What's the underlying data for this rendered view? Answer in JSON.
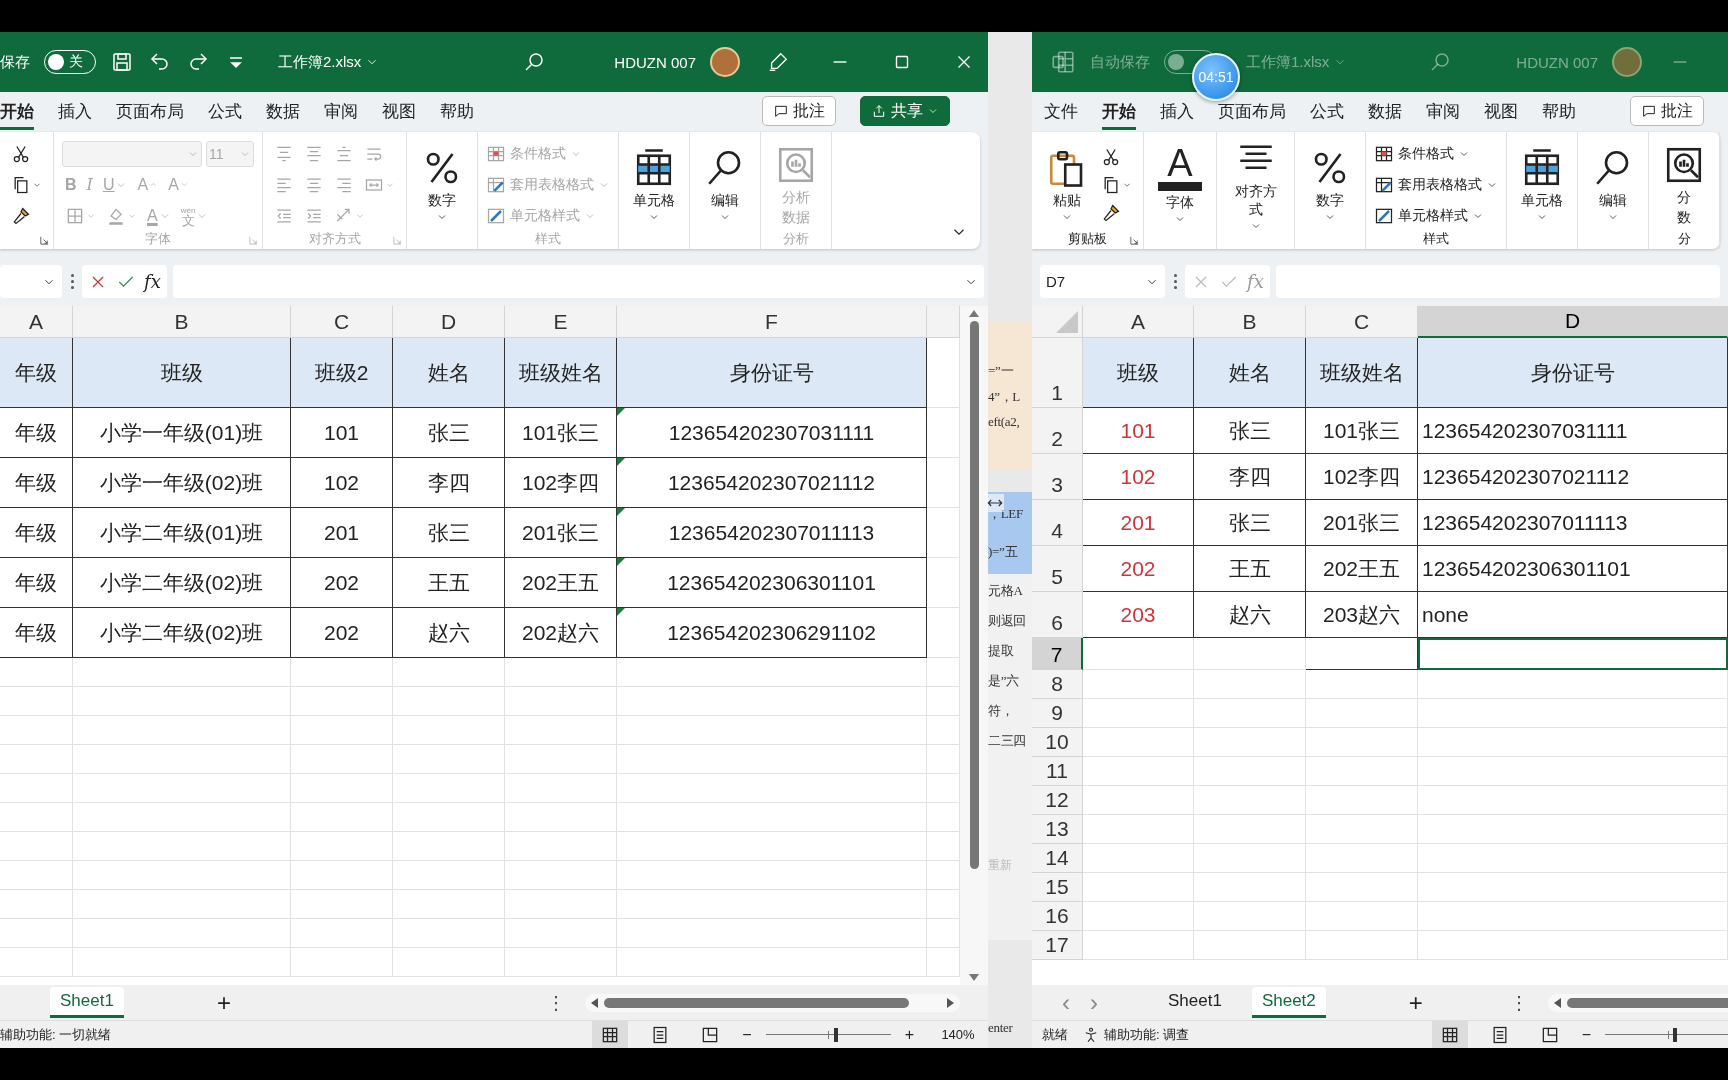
{
  "background_window": {
    "fragments": [
      {
        "kind": "code",
        "text": "=”一"
      },
      {
        "kind": "code",
        "text": "4”，L"
      },
      {
        "kind": "code",
        "text": "eft(a2,"
      },
      {
        "kind": "highlight",
        "text": "，LEF"
      },
      {
        "kind": "highlight",
        "text": ")=”五"
      },
      {
        "kind": "text",
        "text": "元格A"
      },
      {
        "kind": "text",
        "text": "则返回"
      },
      {
        "kind": "text",
        "text": "提取"
      },
      {
        "kind": "text",
        "text": "是”六"
      },
      {
        "kind": "text",
        "text": "符，"
      },
      {
        "kind": "text",
        "text": "二三四"
      },
      {
        "kind": "muted",
        "text": "重新"
      },
      {
        "kind": "footer",
        "text": "enter"
      }
    ]
  },
  "windows": [
    {
      "active": true,
      "title_bar": {
        "autosave_label": "保存",
        "autosave": {
          "on": false,
          "text": "关"
        },
        "quick_access": [
          {
            "kind": "save"
          },
          {
            "kind": "undo"
          },
          {
            "kind": "redo"
          },
          {
            "kind": "customize"
          }
        ],
        "filename": "工作簿2.xlsx",
        "user": "HDUZN 007",
        "controls": [
          {
            "kind": "pen"
          },
          {
            "kind": "minimize"
          },
          {
            "kind": "maximize"
          },
          {
            "kind": "close"
          }
        ]
      },
      "ribbon_tabs": [
        {
          "label": "开始",
          "selected": true
        },
        {
          "label": "插入",
          "selected": false
        },
        {
          "label": "页面布局",
          "selected": false
        },
        {
          "label": "公式",
          "selected": false
        },
        {
          "label": "数据",
          "selected": false
        },
        {
          "label": "审阅",
          "selected": false
        },
        {
          "label": "视图",
          "selected": false
        },
        {
          "label": "帮助",
          "selected": false
        }
      ],
      "ribbon_buttons": [
        {
          "kind": "comment",
          "label": "批注"
        },
        {
          "kind": "share",
          "label": "共享"
        }
      ],
      "ribbon_groups": [
        {
          "disabled": false,
          "launcher": true,
          "rows": [
            [
              {
                "kind": "cut"
              }
            ],
            [
              {
                "kind": "copy",
                "caret": true
              }
            ],
            [
              {
                "kind": "painter"
              }
            ]
          ]
        },
        {
          "label": "字体",
          "disabled": true,
          "launcher": true,
          "rows": [
            [
              {
                "kind": "fontname",
                "caret": true
              },
              {
                "kind": "fontsize",
                "text": "11",
                "caret": true
              }
            ],
            [
              {
                "kind": "bold",
                "text": "B"
              },
              {
                "kind": "italic",
                "text": "I"
              },
              {
                "kind": "underline",
                "text": "U",
                "caret": true
              },
              {
                "kind": "grow",
                "text": "A"
              },
              {
                "kind": "shrink",
                "text": "A"
              }
            ],
            [
              {
                "kind": "border",
                "caret": true
              },
              {
                "kind": "fill",
                "caret": true
              },
              {
                "kind": "fontcolor",
                "text": "A",
                "caret": true
              },
              {
                "kind": "phonetic",
                "text": "文",
                "ruby": "wén",
                "caret": true
              }
            ]
          ]
        },
        {
          "label": "对齐方式",
          "disabled": true,
          "launcher": true,
          "rows": [
            [
              {
                "kind": "align_top"
              },
              {
                "kind": "align_middle"
              },
              {
                "kind": "align_bottom"
              },
              {
                "kind": "wrap"
              }
            ],
            [
              {
                "kind": "align_left"
              },
              {
                "kind": "align_center"
              },
              {
                "kind": "align_right"
              },
              {
                "kind": "merge",
                "caret": true
              }
            ],
            [
              {
                "kind": "indent_dec"
              },
              {
                "kind": "indent_inc"
              },
              {
                "kind": "orient",
                "caret": true
              }
            ]
          ]
        },
        {
          "disabled": false,
          "launcher": false,
          "rows": [
            [
              {
                "kind": "percent",
                "label": "数字",
                "caret": true
              }
            ]
          ]
        },
        {
          "label": "样式",
          "disabled": true,
          "rows": [
            [
              {
                "kind": "condfmt",
                "label": "条件格式",
                "caret": true
              }
            ],
            [
              {
                "kind": "tablefmt",
                "label": "套用表格格式",
                "caret": true
              }
            ],
            [
              {
                "kind": "cellstyle",
                "label": "单元格样式",
                "caret": true
              }
            ]
          ]
        },
        {
          "disabled": false,
          "launcher": false,
          "rows": [
            [
              {
                "kind": "cells",
                "label": "单元格",
                "caret": true
              }
            ]
          ]
        },
        {
          "disabled": false,
          "launcher": false,
          "rows": [
            [
              {
                "kind": "find",
                "label": "编辑",
                "caret": true
              }
            ]
          ]
        },
        {
          "label": "分析",
          "disabled": true,
          "rows": [
            [
              {
                "kind": "analyze",
                "label_lines": [
                  "分析",
                  "数据"
                ]
              }
            ]
          ]
        }
      ],
      "ribbon_collapse": true,
      "formula_bar": {
        "editing": true,
        "fx": "fx"
      },
      "sheet": {
        "columns": [
          {
            "label": "A"
          },
          {
            "label": "B"
          },
          {
            "label": "C"
          },
          {
            "label": "D"
          },
          {
            "label": "E"
          },
          {
            "label": "F"
          }
        ],
        "rows": [
          {
            "kind": "header",
            "cells": [
              "年级",
              "班级",
              "班级2",
              "姓名",
              "班级姓名",
              "身份证号"
            ]
          },
          {
            "kind": "data",
            "flagged": true,
            "cells": [
              "年级",
              "小学一年级(01)班",
              "101",
              "张三",
              "101张三",
              "123654202307031111"
            ]
          },
          {
            "kind": "data",
            "flagged": true,
            "cells": [
              "年级",
              "小学一年级(02)班",
              "102",
              "李四",
              "102李四",
              "123654202307021112"
            ]
          },
          {
            "kind": "data",
            "flagged": true,
            "cells": [
              "年级",
              "小学二年级(01)班",
              "201",
              "张三",
              "201张三",
              "123654202307011113"
            ]
          },
          {
            "kind": "data",
            "flagged": true,
            "cells": [
              "年级",
              "小学二年级(02)班",
              "202",
              "王五",
              "202王五",
              "123654202306301101"
            ]
          },
          {
            "kind": "data",
            "flagged": true,
            "cells": [
              "年级",
              "小学二年级(02)班",
              "202",
              "赵六",
              "202赵六",
              "123654202306291102"
            ]
          }
        ]
      },
      "sheet_bar": {
        "tabs": [
          {
            "label": "Sheet1",
            "selected": true
          }
        ],
        "add": "+",
        "more": "⋮"
      },
      "status": {
        "items": [
          {
            "kind": "text",
            "text": "辅助功能: 一切就绪"
          }
        ],
        "zoom_minus": "−",
        "zoom_plus": "+",
        "zoom_slider": {
          "level": 0.56
        },
        "zoom_text": "140%"
      }
    },
    {
      "active": false,
      "timer": "04:51",
      "title_bar": {
        "app_icon": true,
        "autosave_label": "自动保存",
        "autosave": {
          "on": false
        },
        "filename": "工作簿1.xlsx",
        "user": "HDUZN 007",
        "controls": [
          {
            "kind": "minimize"
          }
        ]
      },
      "ribbon_tabs": [
        {
          "label": "文件",
          "selected": false
        },
        {
          "label": "开始",
          "selected": true
        },
        {
          "label": "插入",
          "selected": false
        },
        {
          "label": "页面布局",
          "selected": false
        },
        {
          "label": "公式",
          "selected": false
        },
        {
          "label": "数据",
          "selected": false
        },
        {
          "label": "审阅",
          "selected": false
        },
        {
          "label": "视图",
          "selected": false
        },
        {
          "label": "帮助",
          "selected": false
        }
      ],
      "ribbon_buttons": [
        {
          "kind": "comment",
          "label": "批注"
        }
      ],
      "ribbon_groups": [
        {
          "label": "剪贴板",
          "disabled": false,
          "launcher": true,
          "rows": [
            [
              {
                "kind": "paste",
                "label": "粘贴",
                "caret": true
              },
              {
                "kind": "column",
                "items": [
                  {
                    "kind": "cut"
                  },
                  {
                    "kind": "copy",
                    "caret": true
                  },
                  {
                    "kind": "painter"
                  }
                ]
              }
            ]
          ]
        },
        {
          "disabled": false,
          "launcher": false,
          "rows": [
            [
              {
                "kind": "fontbig",
                "text": "A",
                "label": "字体",
                "caret": true
              }
            ]
          ]
        },
        {
          "disabled": false,
          "launcher": false,
          "rows": [
            [
              {
                "kind": "alignbig",
                "label": "对齐方式",
                "caret": true
              }
            ]
          ]
        },
        {
          "disabled": false,
          "launcher": false,
          "rows": [
            [
              {
                "kind": "percent",
                "label": "数字",
                "caret": true
              }
            ]
          ]
        },
        {
          "label": "样式",
          "disabled": false,
          "rows": [
            [
              {
                "kind": "condfmt",
                "label": "条件格式",
                "caret": true
              }
            ],
            [
              {
                "kind": "tablefmt",
                "label": "套用表格格式",
                "caret": true
              }
            ],
            [
              {
                "kind": "cellstyle",
                "label": "单元格样式",
                "caret": true
              }
            ]
          ]
        },
        {
          "disabled": false,
          "launcher": false,
          "rows": [
            [
              {
                "kind": "cells",
                "label": "单元格",
                "caret": true
              }
            ]
          ]
        },
        {
          "disabled": false,
          "launcher": false,
          "rows": [
            [
              {
                "kind": "find",
                "label": "编辑",
                "caret": true
              }
            ]
          ]
        },
        {
          "label": "分",
          "disabled": false,
          "rows": [
            [
              {
                "kind": "analyze",
                "label_lines": [
                  "分",
                  "数"
                ]
              }
            ]
          ]
        }
      ],
      "formula_bar": {
        "name_box": "D7",
        "editing": false,
        "fx": "fx"
      },
      "sheet": {
        "columns": [
          {
            "label": "A",
            "selected": false,
            "color": "#d13438"
          },
          {
            "label": "B",
            "selected": false
          },
          {
            "label": "C",
            "selected": false
          },
          {
            "label": "D",
            "selected": true
          }
        ],
        "row_numbers": [
          {
            "label": "1",
            "selected": false
          },
          {
            "label": "2",
            "selected": false
          },
          {
            "label": "3",
            "selected": false
          },
          {
            "label": "4",
            "selected": false
          },
          {
            "label": "5",
            "selected": false
          },
          {
            "label": "6",
            "selected": false
          },
          {
            "label": "7",
            "selected": true
          },
          {
            "label": "8",
            "selected": false
          },
          {
            "label": "9",
            "selected": false
          },
          {
            "label": "10",
            "selected": false
          },
          {
            "label": "11",
            "selected": false
          },
          {
            "label": "12",
            "selected": false
          },
          {
            "label": "13",
            "selected": false
          },
          {
            "label": "14",
            "selected": false
          },
          {
            "label": "15",
            "selected": false
          },
          {
            "label": "16",
            "selected": false
          },
          {
            "label": "17",
            "selected": false
          }
        ],
        "rows": [
          {
            "kind": "header",
            "cells": [
              "班级",
              "姓名",
              "班级姓名",
              "身份证号"
            ]
          },
          {
            "kind": "data",
            "cells": [
              "101",
              "张三",
              "101张三",
              "123654202307031111"
            ]
          },
          {
            "kind": "data",
            "cells": [
              "102",
              "李四",
              "102李四",
              "123654202307021112"
            ]
          },
          {
            "kind": "data",
            "cells": [
              "201",
              "张三",
              "201张三",
              "123654202307011113"
            ]
          },
          {
            "kind": "data",
            "cells": [
              "202",
              "王五",
              "202王五",
              "123654202306301101"
            ]
          },
          {
            "kind": "data",
            "cells": [
              "203",
              "赵六",
              "203赵六",
              "none"
            ]
          }
        ]
      },
      "sheet_bar": {
        "nav": [
          "‹",
          "›"
        ],
        "tabs": [
          {
            "label": "Sheet1",
            "selected": false
          },
          {
            "label": "Sheet2",
            "selected": true
          }
        ],
        "add": "+",
        "more": "⋮"
      },
      "status": {
        "items": [
          {
            "kind": "text",
            "text": "就绪"
          },
          {
            "kind": "accessibility",
            "text": "辅助功能: 调查"
          }
        ],
        "zoom_minus": "−",
        "zoom_slider": {
          "level": 0.56
        }
      }
    }
  ]
}
